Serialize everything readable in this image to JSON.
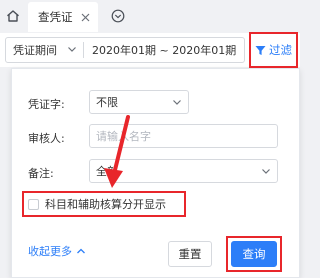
{
  "tabs": {
    "home_icon": "home-icon",
    "active": {
      "label": "查凭证",
      "close_icon": "close-icon"
    },
    "menu_icon": "chevron-circle-down-icon"
  },
  "toolbar": {
    "period_select": {
      "value": "凭证期间",
      "icon": "chevron-down-icon"
    },
    "period_range": "2020年01期 ~ 2020年01期",
    "filter_button": {
      "label": "过滤",
      "icon": "funnel-icon"
    }
  },
  "filter_panel": {
    "voucher_word": {
      "label": "凭证字:",
      "value": "不限"
    },
    "reviewer": {
      "label": "审核人:",
      "placeholder": "请输入名字"
    },
    "note": {
      "label": "备注:",
      "value": "全部"
    },
    "split_display": {
      "label": "科目和辅助核算分开显示",
      "checked": false
    },
    "collapse_link": {
      "label": "收起更多",
      "icon": "chevron-up-icon"
    },
    "reset_button": "重置",
    "query_button": "查询"
  },
  "colors": {
    "accent": "#2c7ef8",
    "annotation": "#e8262b"
  }
}
